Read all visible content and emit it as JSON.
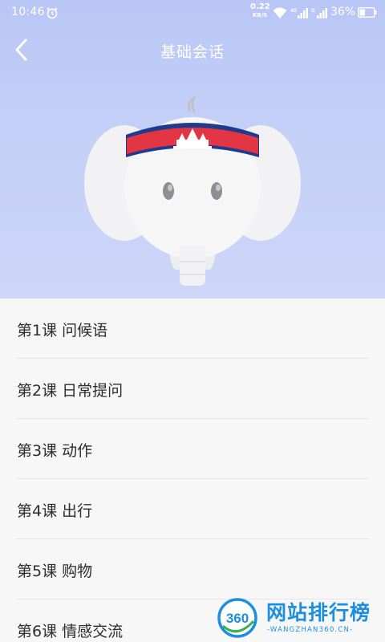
{
  "status_bar": {
    "time": "10:46",
    "net_speed_value": "0.22",
    "net_speed_unit": "KB/S",
    "battery_percent": "36%",
    "icons": [
      "alarm-icon",
      "wifi-icon",
      "4g-signal-icon",
      "signal-icon",
      "battery-icon"
    ]
  },
  "header": {
    "title": "基础会话",
    "back_icon": "chevron-left-icon"
  },
  "hero": {
    "illustration": "elephant-mascot-with-cambodia-headband"
  },
  "lessons": [
    {
      "label": "第1课 问候语"
    },
    {
      "label": "第2课 日常提问"
    },
    {
      "label": "第3课 动作"
    },
    {
      "label": "第4课 出行"
    },
    {
      "label": "第5课 购物"
    },
    {
      "label": "第6课 情感交流"
    }
  ],
  "watermark": {
    "badge": "360",
    "title": "网站排行榜",
    "subtitle": "-WANGZHAN360.CN-"
  },
  "colors": {
    "hero_bg": "#c4cff7",
    "list_bg": "#f7f7f7",
    "text": "#2d2d2d",
    "watermark": "#1d8fe0"
  }
}
